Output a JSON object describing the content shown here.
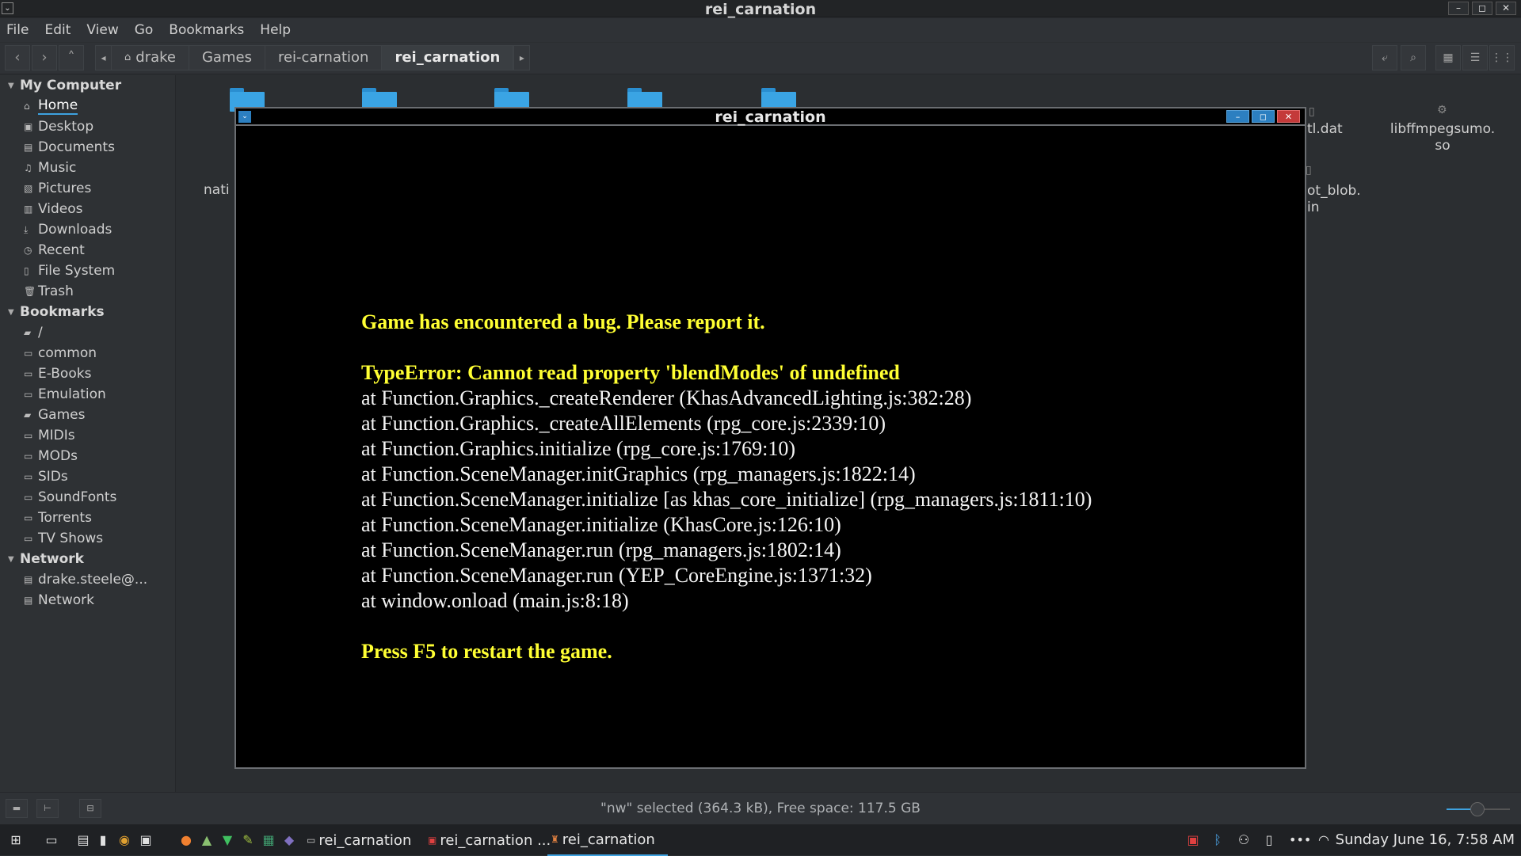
{
  "window": {
    "title": "rei_carnation"
  },
  "menubar": [
    "File",
    "Edit",
    "View",
    "Go",
    "Bookmarks",
    "Help"
  ],
  "breadcrumbs": [
    "drake",
    "Games",
    "rei-carnation",
    "rei_carnation"
  ],
  "sidebar": {
    "sections": [
      {
        "title": "My Computer",
        "items": [
          {
            "label": "Home",
            "icon": "home-icon"
          },
          {
            "label": "Desktop",
            "icon": "desktop-icon"
          },
          {
            "label": "Documents",
            "icon": "documents-icon"
          },
          {
            "label": "Music",
            "icon": "music-icon"
          },
          {
            "label": "Pictures",
            "icon": "pictures-icon"
          },
          {
            "label": "Videos",
            "icon": "videos-icon"
          },
          {
            "label": "Downloads",
            "icon": "downloads-icon"
          },
          {
            "label": "Recent",
            "icon": "recent-icon"
          },
          {
            "label": "File System",
            "icon": "drive-icon"
          },
          {
            "label": "Trash",
            "icon": "trash-icon"
          }
        ]
      },
      {
        "title": "Bookmarks",
        "items": [
          {
            "label": "/",
            "icon": "folder-icon"
          },
          {
            "label": "common",
            "icon": "folder-icon"
          },
          {
            "label": "E-Books",
            "icon": "folder-icon"
          },
          {
            "label": "Emulation",
            "icon": "folder-icon"
          },
          {
            "label": "Games",
            "icon": "folder-icon"
          },
          {
            "label": "MIDIs",
            "icon": "folder-icon"
          },
          {
            "label": "MODs",
            "icon": "folder-icon"
          },
          {
            "label": "SIDs",
            "icon": "folder-icon"
          },
          {
            "label": "SoundFonts",
            "icon": "folder-icon"
          },
          {
            "label": "Torrents",
            "icon": "folder-icon"
          },
          {
            "label": "TV Shows",
            "icon": "folder-icon"
          }
        ]
      },
      {
        "title": "Network",
        "items": [
          {
            "label": "drake.steele@...",
            "icon": "network-drive-icon"
          },
          {
            "label": "Network",
            "icon": "network-icon"
          }
        ]
      }
    ]
  },
  "content": {
    "visible_labels": [
      "nati",
      "tl.dat",
      "libffmpegsumo.",
      "so",
      "ot_blob.",
      "in"
    ]
  },
  "status": {
    "text": "\"nw\" selected (364.3 kB), Free space: 117.5 GB"
  },
  "game_window": {
    "title": "rei_carnation",
    "error_heading": "Game has encountered a bug. Please report it.",
    "error_type": "TypeError: Cannot read property 'blendModes' of undefined",
    "stack": [
      "at Function.Graphics._createRenderer (KhasAdvancedLighting.js:382:28)",
      "at Function.Graphics._createAllElements (rpg_core.js:2339:10)",
      "at Function.Graphics.initialize (rpg_core.js:1769:10)",
      "at Function.SceneManager.initGraphics (rpg_managers.js:1822:14)",
      "at Function.SceneManager.initialize [as khas_core_initialize] (rpg_managers.js:1811:10)",
      "at Function.SceneManager.initialize (KhasCore.js:126:10)",
      "at Function.SceneManager.run (rpg_managers.js:1802:14)",
      "at Function.SceneManager.run (YEP_CoreEngine.js:1371:32)",
      "at window.onload (main.js:8:18)"
    ],
    "restart_hint": "Press F5 to restart the game."
  },
  "taskbar": {
    "tasks": [
      "rei_carnation",
      "rei_carnation ...",
      "rei_carnation"
    ],
    "clock": "Sunday June 16,  7:58 AM"
  },
  "colors": {
    "accent": "#3ea2e0",
    "error_yellow": "#ffff33",
    "folder_blue": "#3aa4e4"
  }
}
